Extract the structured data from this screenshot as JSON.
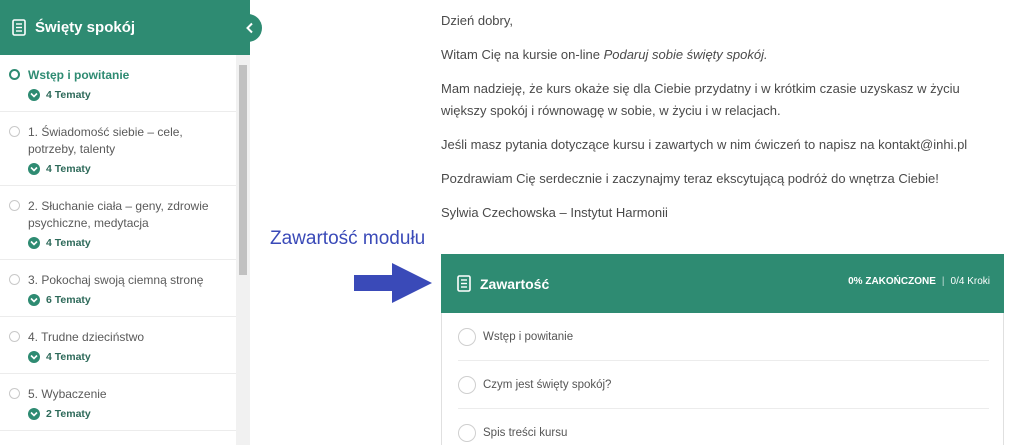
{
  "sidebar": {
    "title": "Święty spokój",
    "lessons": [
      {
        "title": "Wstęp i powitanie",
        "topics": "4 Tematy"
      },
      {
        "title": "1. Świadomość siebie – cele, potrzeby, talenty",
        "topics": "4 Tematy"
      },
      {
        "title": "2. Słuchanie ciała – geny, zdrowie psychiczne, medytacja",
        "topics": "4 Tematy"
      },
      {
        "title": "3. Pokochaj swoją ciemną stronę",
        "topics": "6 Tematy"
      },
      {
        "title": "4. Trudne dzieciństwo",
        "topics": "4 Tematy"
      },
      {
        "title": "5. Wybaczenie",
        "topics": "2 Tematy"
      }
    ]
  },
  "content": {
    "greeting": "Dzień dobry,",
    "welcome_prefix": "Witam Cię na kursie on-line ",
    "welcome_title": "Podaruj sobie święty spokój.",
    "hope": "Mam nadzieję, że kurs okaże się dla Ciebie przydatny i w krótkim czasie uzyskasz w życiu większy spokój i równowagę w sobie, w życiu i w relacjach.",
    "questions": "Jeśli masz pytania dotyczące kursu i zawartych w nim ćwiczeń to napisz na kontakt@inhi.pl",
    "regards": "Pozdrawiam Cię serdecznie i zaczynajmy teraz ekscytującą podróż do wnętrza Ciebie!",
    "signature": "Sylwia Czechowska – Instytut Harmonii"
  },
  "annotation": "Zawartość modułu",
  "panel": {
    "title": "Zawartość",
    "progress_percent": "0% ZAKOŃCZONE",
    "steps_count": "0/4 Kroki",
    "steps": [
      "Wstęp i powitanie",
      "Czym jest święty spokój?",
      "Spis treści kursu"
    ]
  },
  "colors": {
    "brand": "#2e8b72",
    "annotation": "#3a4ab8"
  }
}
